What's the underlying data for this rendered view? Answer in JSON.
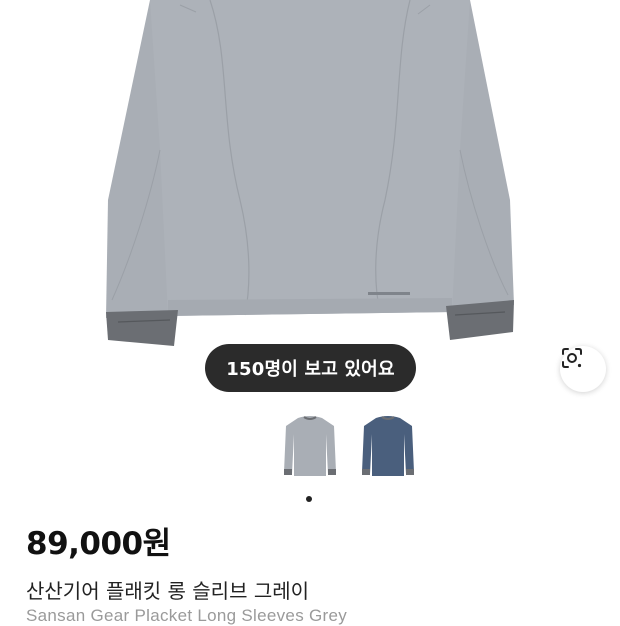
{
  "product": {
    "viewer_badge": "150명이 보고 있어요",
    "price": "89,000원",
    "name_ko": "산산기어 플래킷 롱 슬리브 그레이",
    "name_en": "Sansan Gear Placket Long Sleeves Grey",
    "colors": {
      "shirt_grey": "#a9aeb5",
      "cuff_grey": "#6b6e73",
      "navy": "#4a5f7d"
    },
    "thumbnails": [
      {
        "label": "grey",
        "selected": true
      },
      {
        "label": "navy",
        "selected": false
      }
    ]
  }
}
